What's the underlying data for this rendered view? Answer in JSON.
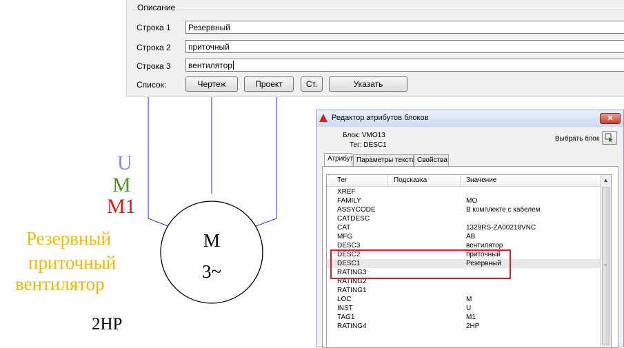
{
  "description_panel": {
    "group_title": "Описание",
    "rows": [
      {
        "label": "Строка 1",
        "value": "Резервный"
      },
      {
        "label": "Строка 2",
        "value": "приточный"
      },
      {
        "label": "Строка 3",
        "value": "вентилятор"
      }
    ],
    "list_label": "Список:",
    "buttons": {
      "drawing": "Чертеж",
      "project": "Проект",
      "st": "Ст.",
      "specify": "Указать"
    }
  },
  "schematic": {
    "attributes": [
      {
        "text": "U",
        "color": "#8888ee"
      },
      {
        "text": "M",
        "color": "#4a9a1a"
      },
      {
        "text": "M1",
        "color": "#e01818"
      },
      {
        "text": "Резервный",
        "color": "#f5b800"
      },
      {
        "text": "приточный",
        "color": "#f5b800"
      },
      {
        "text": "вентилятор",
        "color": "#f5b800"
      },
      {
        "text": "2HP",
        "color": "#000000"
      }
    ],
    "motor_label": "M",
    "motor_phase": "3~",
    "wire_color": "#2a2ad8"
  },
  "dialog": {
    "title": "Редактор атрибутов блоков",
    "close_icon": "x-icon",
    "block_label": "Блок: VMO13",
    "tag_label": "Тег: DESC1",
    "pick_block_label": "Выбрать блок",
    "tabs": [
      "Атрибут",
      "Параметры текста",
      "Свойства"
    ],
    "grid_headers": [
      "Тег",
      "Подсказка",
      "Значение"
    ],
    "rows": [
      {
        "tag": "XREF",
        "value": ""
      },
      {
        "tag": "FAMILY",
        "value": "MO"
      },
      {
        "tag": "ASSYCODE",
        "value": "В комплекте с кабелем"
      },
      {
        "tag": "CATDESC",
        "value": ""
      },
      {
        "tag": "CAT",
        "value": "1329RS-ZA00218VNC"
      },
      {
        "tag": "MFG",
        "value": "AB"
      },
      {
        "tag": "DESC3",
        "value": "вентилятор"
      },
      {
        "tag": "DESC2",
        "value": "приточный"
      },
      {
        "tag": "DESC1",
        "value": "Резервный"
      },
      {
        "tag": "RATING3",
        "value": ""
      },
      {
        "tag": "RATING2",
        "value": ""
      },
      {
        "tag": "RATING1",
        "value": ""
      },
      {
        "tag": "LOC",
        "value": "M"
      },
      {
        "tag": "INST",
        "value": "U"
      },
      {
        "tag": "TAG1",
        "value": "M1"
      },
      {
        "tag": "RATING4",
        "value": "2HP"
      }
    ],
    "highlight_color": "#d81e2a"
  }
}
